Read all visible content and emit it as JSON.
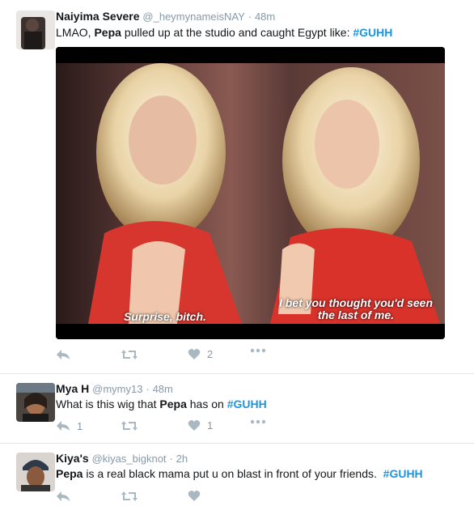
{
  "tweets": [
    {
      "name": "Naiyima Severe",
      "handle": "@_heymynameisNAY",
      "dot": "·",
      "time": "48m",
      "text_a": "LMAO, ",
      "text_b": "Pepa",
      "text_c": " pulled up at the studio and caught Egypt like: ",
      "hashtag": "#GUHH",
      "caption_left": "Surprise, bitch.",
      "caption_right_1": "I bet you thought you'd seen",
      "caption_right_2": "the last of me.",
      "reply_count": "",
      "retweet_count": "",
      "like_count": "2"
    },
    {
      "name": "Mya H",
      "handle": "@mymy13",
      "dot": "·",
      "time": "48m",
      "text_a": "What is this wig that ",
      "text_b": "Pepa",
      "text_c": " has on ",
      "hashtag": "#GUHH",
      "reply_count": "1",
      "retweet_count": "",
      "like_count": "1"
    },
    {
      "name": "Kiya's",
      "handle": "@kiyas_bigknot",
      "dot": "·",
      "time": "2h",
      "text_a": "",
      "text_b": "Pepa",
      "text_c": " is a real black mama put u on blast in front of your friends.  ",
      "hashtag": "#GUHH"
    }
  ],
  "colors": {
    "accent": "#1b95e0",
    "muted": "#8899a6",
    "icon": "#aab8c2",
    "border": "#e1e8ed"
  },
  "icons": [
    "reply-icon",
    "retweet-icon",
    "heart-icon",
    "more-icon"
  ]
}
